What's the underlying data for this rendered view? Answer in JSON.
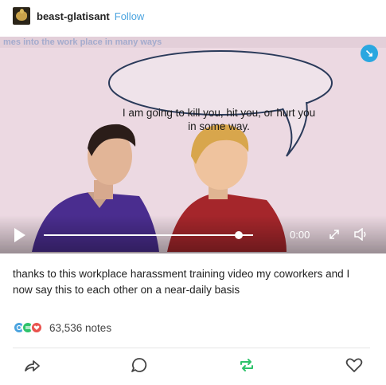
{
  "post": {
    "username": "beast-glatisant",
    "follow_label": "Follow"
  },
  "video": {
    "speech_bubble": "I am going to kill you, hit you, or hurt you in some way.",
    "top_text": "...mes into the work place in many ways...",
    "time": "0:00",
    "progress": 0.93
  },
  "caption": "thanks to this workplace harassment training video my coworkers and I now say this to each other on a near-daily basis",
  "notes": {
    "count_label": "63,536 notes",
    "colors": {
      "reblog": "#4aa3df",
      "repost": "#2ec36b",
      "like": "#e9534e"
    }
  },
  "actions": {
    "share": "share-icon",
    "reply": "reply-icon",
    "reblog": "reblog-icon",
    "like": "heart-icon"
  }
}
